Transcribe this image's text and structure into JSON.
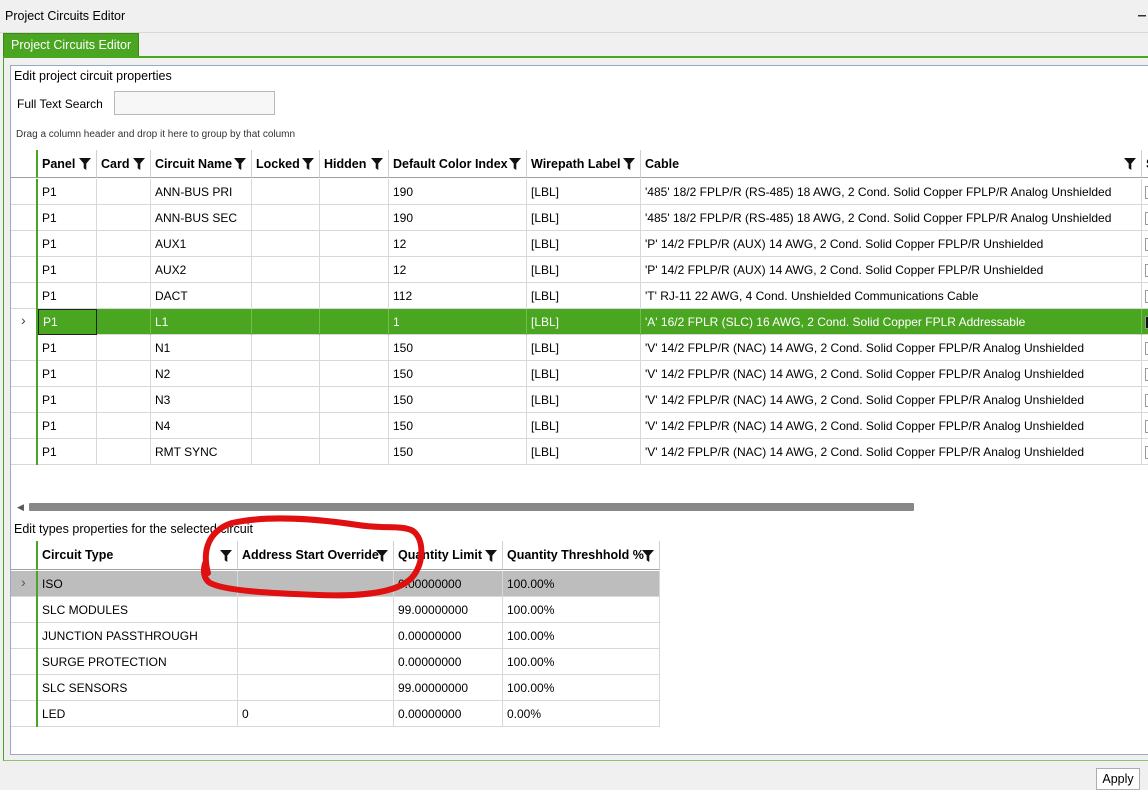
{
  "window": {
    "title": "Project Circuits Editor"
  },
  "tab": {
    "label": "Project Circuits Editor"
  },
  "circuits_section": {
    "title": "Edit project circuit properties",
    "search": {
      "label": "Full Text Search",
      "value": "",
      "placeholder": ""
    },
    "group_hint": "Drag a column header and drop it here to group by that column",
    "columns": [
      "Panel",
      "Card",
      "Circuit Name",
      "Locked",
      "Hidden",
      "Default Color Index",
      "Wirepath Label",
      "Cable",
      "S"
    ],
    "rows": [
      {
        "panel": "P1",
        "card": "",
        "name": "ANN-BUS PRI",
        "locked": "",
        "hidden": "",
        "color": "190",
        "wirepath": "[LBL]",
        "cable": "'485' 18/2 FPLP/R (RS-485) 18 AWG, 2 Cond. Solid Copper FPLP/R Analog Unshielded"
      },
      {
        "panel": "P1",
        "card": "",
        "name": "ANN-BUS SEC",
        "locked": "",
        "hidden": "",
        "color": "190",
        "wirepath": "[LBL]",
        "cable": "'485' 18/2 FPLP/R (RS-485) 18 AWG, 2 Cond. Solid Copper FPLP/R Analog Unshielded"
      },
      {
        "panel": "P1",
        "card": "",
        "name": "AUX1",
        "locked": "",
        "hidden": "",
        "color": "12",
        "wirepath": "[LBL]",
        "cable": "'P' 14/2 FPLP/R (AUX) 14 AWG, 2 Cond. Solid Copper FPLP/R  Unshielded"
      },
      {
        "panel": "P1",
        "card": "",
        "name": "AUX2",
        "locked": "",
        "hidden": "",
        "color": "12",
        "wirepath": "[LBL]",
        "cable": "'P' 14/2 FPLP/R (AUX) 14 AWG, 2 Cond. Solid Copper FPLP/R  Unshielded"
      },
      {
        "panel": "P1",
        "card": "",
        "name": "DACT",
        "locked": "",
        "hidden": "",
        "color": "112",
        "wirepath": "[LBL]",
        "cable": "'T' RJ-11 22 AWG, 4 Cond. Unshielded Communications Cable"
      },
      {
        "panel": "P1",
        "card": "",
        "name": "L1",
        "locked": "",
        "hidden": "",
        "color": "1",
        "wirepath": "[LBL]",
        "cable": "'A' 16/2 FPLR (SLC) 16 AWG, 2 Cond. Solid Copper FPLR Addressable",
        "selected": true
      },
      {
        "panel": "P1",
        "card": "",
        "name": "N1",
        "locked": "",
        "hidden": "",
        "color": "150",
        "wirepath": "[LBL]",
        "cable": "'V' 14/2 FPLP/R (NAC) 14 AWG, 2 Cond. Solid Copper FPLP/R Analog Unshielded"
      },
      {
        "panel": "P1",
        "card": "",
        "name": "N2",
        "locked": "",
        "hidden": "",
        "color": "150",
        "wirepath": "[LBL]",
        "cable": "'V' 14/2 FPLP/R (NAC) 14 AWG, 2 Cond. Solid Copper FPLP/R Analog Unshielded"
      },
      {
        "panel": "P1",
        "card": "",
        "name": "N3",
        "locked": "",
        "hidden": "",
        "color": "150",
        "wirepath": "[LBL]",
        "cable": "'V' 14/2 FPLP/R (NAC) 14 AWG, 2 Cond. Solid Copper FPLP/R Analog Unshielded"
      },
      {
        "panel": "P1",
        "card": "",
        "name": "N4",
        "locked": "",
        "hidden": "",
        "color": "150",
        "wirepath": "[LBL]",
        "cable": "'V' 14/2 FPLP/R (NAC) 14 AWG, 2 Cond. Solid Copper FPLP/R Analog Unshielded"
      },
      {
        "panel": "P1",
        "card": "",
        "name": "RMT SYNC",
        "locked": "",
        "hidden": "",
        "color": "150",
        "wirepath": "[LBL]",
        "cable": "'V' 14/2 FPLP/R (NAC) 14 AWG, 2 Cond. Solid Copper FPLP/R Analog Unshielded"
      }
    ]
  },
  "types_section": {
    "title": "Edit types properties for the selected circuit",
    "columns": [
      "Circuit Type",
      "Address Start Override",
      "Quantity Limit",
      "Quantity Threshhold %"
    ],
    "rows": [
      {
        "type": "ISO",
        "address": "",
        "limit": "0.00000000",
        "threshold": "100.00%",
        "selected": true
      },
      {
        "type": "SLC MODULES",
        "address": "",
        "limit": "99.00000000",
        "threshold": "100.00%"
      },
      {
        "type": "JUNCTION PASSTHROUGH",
        "address": "",
        "limit": "0.00000000",
        "threshold": "100.00%"
      },
      {
        "type": "SURGE PROTECTION",
        "address": "",
        "limit": "0.00000000",
        "threshold": "100.00%"
      },
      {
        "type": "SLC SENSORS",
        "address": "",
        "limit": "99.00000000",
        "threshold": "100.00%"
      },
      {
        "type": "LED",
        "address": "0",
        "limit": "0.00000000",
        "threshold": "0.00%"
      }
    ]
  },
  "apply_label": "Apply",
  "colors": {
    "accent": "#4aa521",
    "selected_secondary": "#bdbdbd",
    "annotation": "#e01010"
  },
  "icons": [
    "filter-icon",
    "row-indicator-arrow-icon",
    "checkbox-icon",
    "minimize-icon"
  ]
}
